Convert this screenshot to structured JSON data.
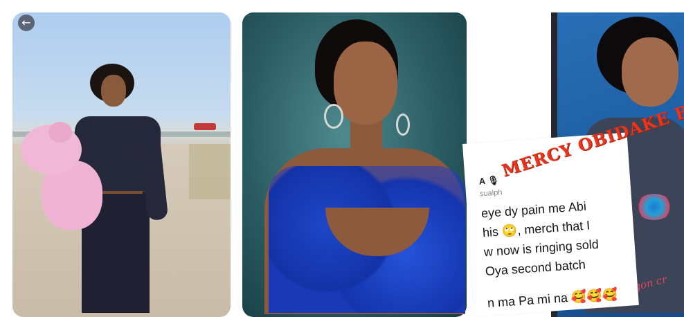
{
  "gallery": {
    "back_icon_glyph": "←",
    "cards": [
      {
        "name": "photo-1"
      },
      {
        "name": "photo-2"
      },
      {
        "name": "photo-3",
        "tweet": {
          "handle": "A 🎙",
          "subhandle": "sualph",
          "lines": [
            "eye dy pain me Abi",
            "his 🙄, merch that I",
            "w now is ringing sold",
            "Oya second batch",
            "n ma Pa mi na 🥰🥰🥰"
          ]
        },
        "watermark": "MERCY OBIDAKE BLOG",
        "shirt_text": "gon cr"
      }
    ]
  }
}
